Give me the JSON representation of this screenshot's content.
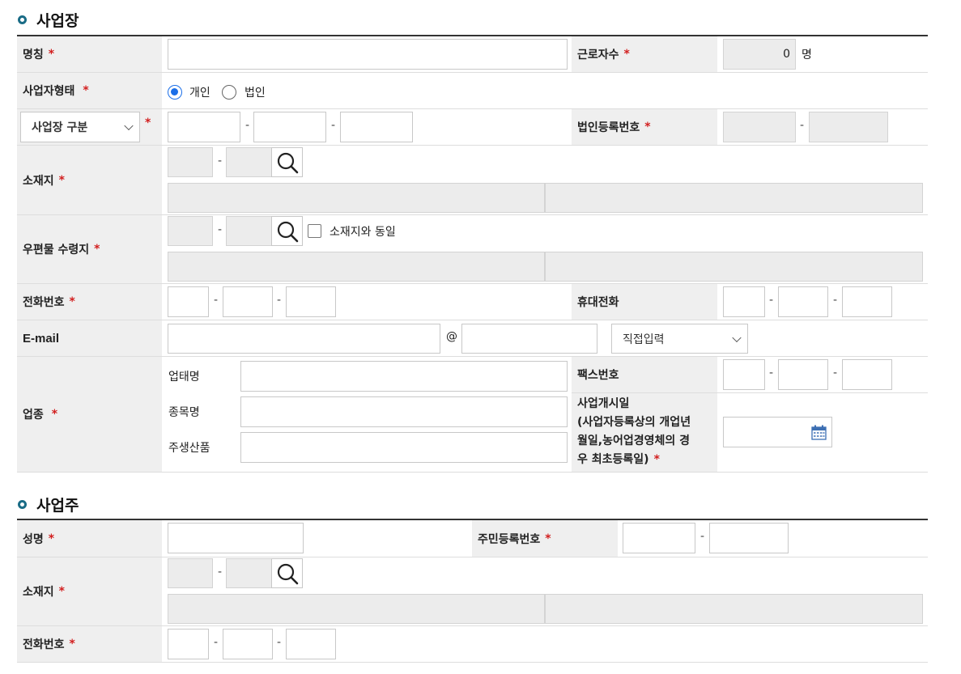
{
  "workplace": {
    "title": "사업장",
    "name_label": "명칭",
    "req": "*",
    "workers_label": "근로자수",
    "workers_value": "0",
    "workers_unit": "명",
    "biz_type_label": "사업자형태",
    "radio_individual": "개인",
    "radio_corporate": "법인",
    "biz_division_select": "사업장 구분",
    "corp_reg_label": "법인등록번호",
    "location_label": "소재지",
    "mail_label": "우편물 수령지",
    "same_as_location": "소재지와 동일",
    "phone_label": "전화번호",
    "mobile_label": "휴대전화",
    "email_label": "E-mail",
    "at": "@",
    "email_domain_select": "직접입력",
    "industry_label": "업종",
    "business_type_label": "업태명",
    "item_label": "종목명",
    "main_product_label": "주생산품",
    "fax_label": "팩스번호",
    "start_date_label_lines": [
      "사업개시일",
      "(사업자등록상의 개업년",
      "월일,농어업경영체의 경",
      "우 최초등록일)"
    ],
    "dash": "-"
  },
  "owner": {
    "title": "사업주",
    "name_label": "성명",
    "resident_reg_label": "주민등록번호",
    "location_label": "소재지",
    "phone_label": "전화번호"
  },
  "icons": {
    "search": "magnifier-icon",
    "calendar": "calendar-icon",
    "section": "circle-bullet-icon"
  },
  "colors": {
    "accent": "#1a6c86",
    "required": "#d21e1e",
    "label_bg": "#efefef",
    "radio": "#1a6ee8"
  }
}
